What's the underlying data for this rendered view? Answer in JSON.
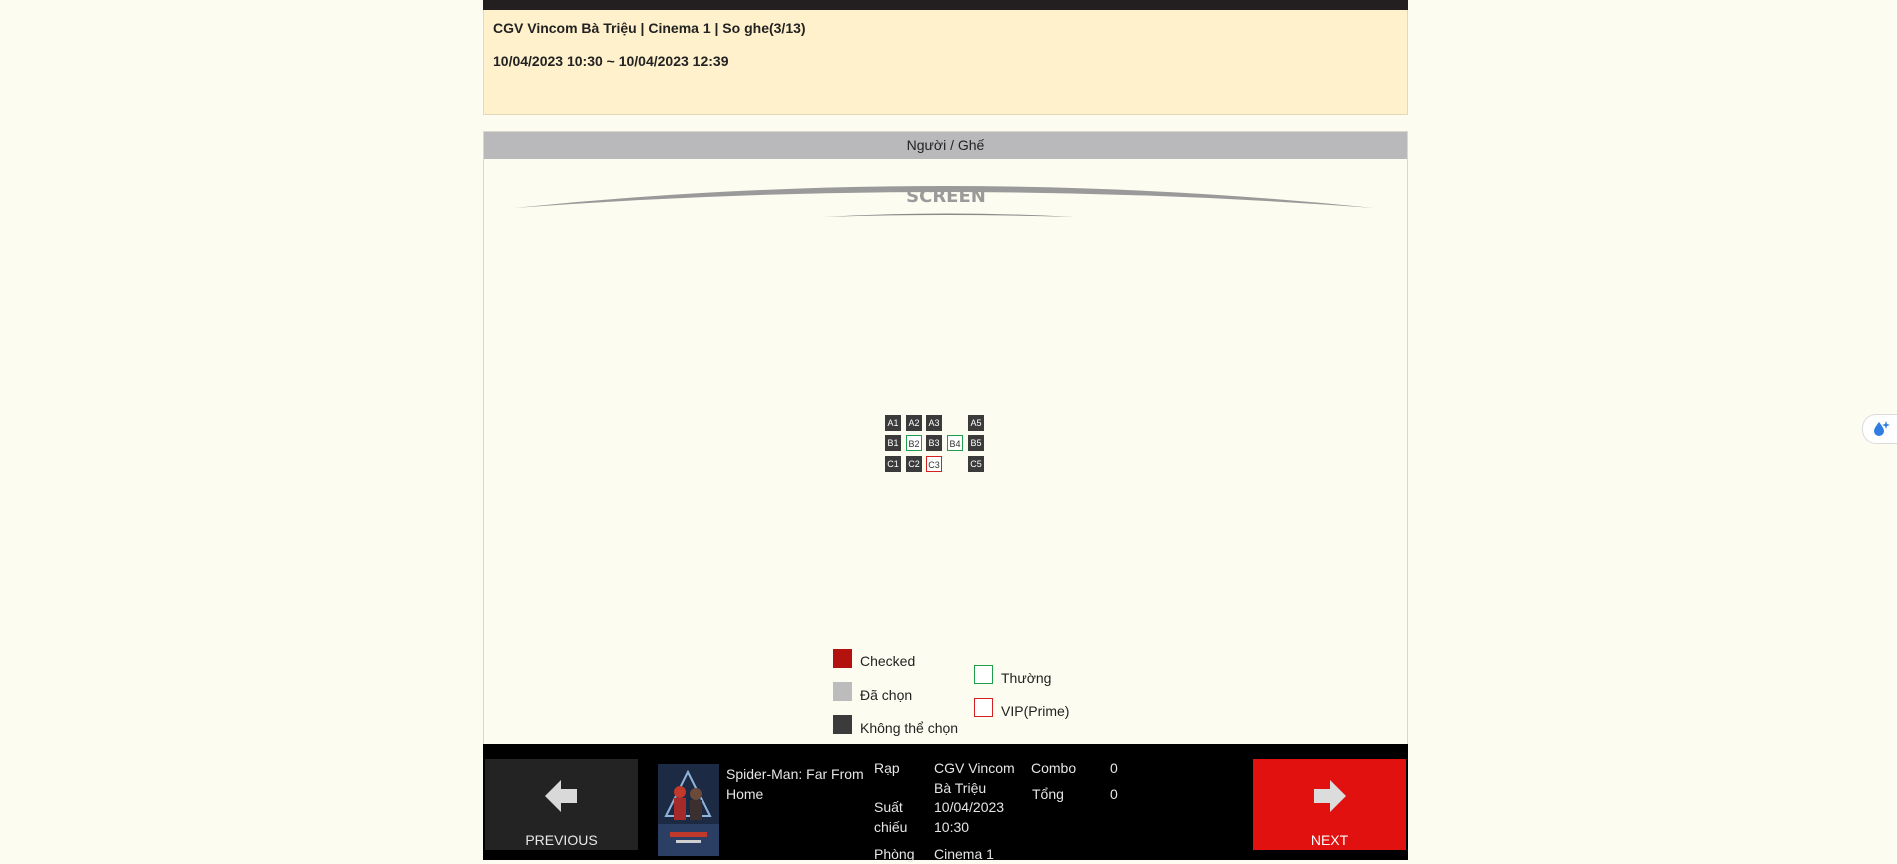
{
  "header": {
    "line1": "CGV Vincom Bà Triệu | Cinema 1 | So ghe(3/13)",
    "line2": "10/04/2023 10:30 ~ 10/04/2023 12:39"
  },
  "seat_panel": {
    "title": "Người / Ghế",
    "screen_label": "SCREEN",
    "seats": {
      "A1": "A1",
      "A2": "A2",
      "A3": "A3",
      "A5": "A5",
      "B1": "B1",
      "B2": "B2",
      "B3": "B3",
      "B4": "B4",
      "B5": "B5",
      "C1": "C1",
      "C2": "C2",
      "C3": "C3",
      "C5": "C5"
    }
  },
  "legend": {
    "checked": "Checked",
    "selected": "Đã chọn",
    "unavailable": "Không thể chọn",
    "normal": "Thường",
    "vip": "VIP(Prime)"
  },
  "colors": {
    "checked": "#b3120f",
    "selected": "#bcbcbc",
    "unavailable": "#3b3b3b",
    "normal": "#1e9e4a",
    "vip": "#d42020",
    "next_button": "#e0110f"
  },
  "bottom": {
    "previous_label": "PREVIOUS",
    "next_label": "NEXT",
    "movie_title": "Spider-Man: Far From Home",
    "rap_label": "Rạp",
    "rap_value": "CGV Vincom Bà Triệu",
    "suat_label": "Suất chiếu",
    "suat_value_date": "10/04/2023",
    "suat_value_time": "10:30",
    "phong_label": "Phòng",
    "phong_value": "Cinema 1",
    "combo_label": "Combo",
    "combo_value": "0",
    "tong_label": "Tổng",
    "tong_value": "0"
  }
}
